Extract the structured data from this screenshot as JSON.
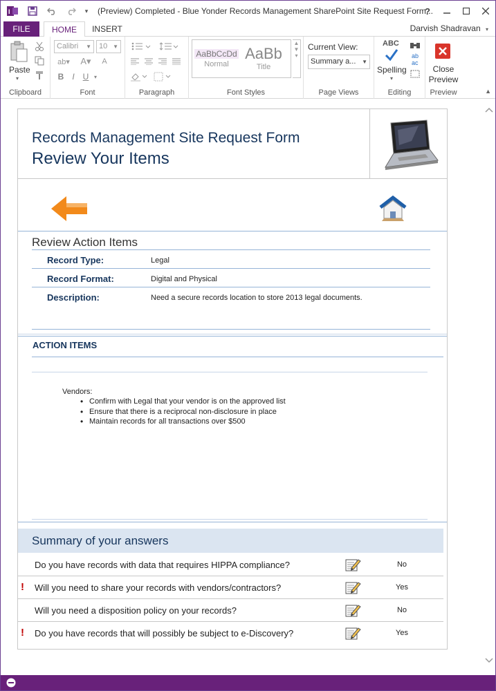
{
  "window": {
    "title": "(Preview) Completed - Blue Yonder Records Management SharePoint Site Request Form...",
    "help_label": "?",
    "user": "Darvish Shadravan"
  },
  "tabs": {
    "file": "FILE",
    "home": "HOME",
    "insert": "INSERT"
  },
  "ribbon": {
    "clipboard": {
      "paste_label": "Paste",
      "group_label": "Clipboard"
    },
    "font": {
      "font_name": "Calibri",
      "font_size": "10",
      "group_label": "Font",
      "bold": "B",
      "italic": "I",
      "underline": "U"
    },
    "paragraph": {
      "group_label": "Paragraph"
    },
    "font_styles": {
      "normal_preview": "AaBbCcDd",
      "normal_label": "Normal",
      "title_preview": "AaBb",
      "title_label": "Title",
      "group_label": "Font Styles"
    },
    "page_views": {
      "current_view_label": "Current View:",
      "current_view_value": "Summary a...",
      "group_label": "Page Views"
    },
    "editing": {
      "spelling_label": "Spelling",
      "spelling_abc": "ABC",
      "group_label": "Editing"
    },
    "preview": {
      "close_label": "Close",
      "preview_label": "Preview",
      "group_label": "Preview"
    }
  },
  "form": {
    "header_subtitle": "Records Management Site Request Form",
    "header_title": "Review Your Items",
    "section_review": {
      "title": "Review Action Items",
      "fields": [
        {
          "label": "Record Type:",
          "value": "Legal"
        },
        {
          "label": "Record Format:",
          "value": "Digital and Physical"
        },
        {
          "label": "Description:",
          "value": "Need a secure records location to store 2013 legal documents."
        }
      ]
    },
    "action_items": {
      "title": "ACTION ITEMS",
      "vendors_label": "Vendors:",
      "items": [
        "Confirm with Legal that your vendor is on the approved list",
        "Ensure that there is a reciprocal non-disclosure in place",
        "Maintain records for all transactions over $500"
      ]
    },
    "summary": {
      "title": "Summary of your answers",
      "rows": [
        {
          "flag": "",
          "question": "Do you have records with data that requires HIPPA compliance?",
          "answer": "No"
        },
        {
          "flag": "!",
          "question": "Will you need to share your records with vendors/contractors?",
          "answer": "Yes"
        },
        {
          "flag": "",
          "question": "Will you need a disposition policy on your records?",
          "answer": "No"
        },
        {
          "flag": "!",
          "question": "Do you have records that will possibly be subject to e-Discovery?",
          "answer": "Yes"
        }
      ]
    }
  },
  "colors": {
    "accent": "#68217a",
    "heading": "#17365d",
    "rule": "#95b3d7",
    "summary_bar": "#dbe5f1",
    "flag": "#c00000",
    "arrow": "#f28a1b",
    "close_button": "#d9352b"
  }
}
